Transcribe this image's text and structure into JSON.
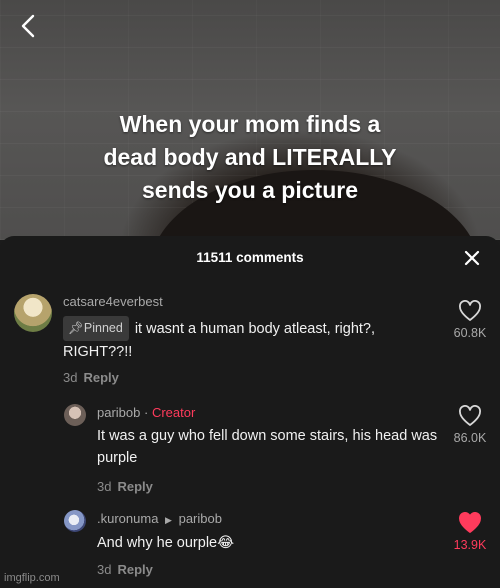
{
  "video": {
    "caption": "When your mom finds a\ndead body and LITERALLY\nsends you a picture"
  },
  "comments_sheet": {
    "count_label": "11511 comments",
    "comments": [
      {
        "username": "catsare4everbest",
        "pinned_label": "Pinned",
        "text": "it wasnt a human body atleast, right?,",
        "text_cont": "RIGHT??!!",
        "age": "3d",
        "reply_label": "Reply",
        "likes": "60.8K"
      },
      {
        "username": "paribob",
        "separator": " · ",
        "creator_label": "Creator",
        "text": "It was a guy who fell down some stairs, his head was purple",
        "age": "3d",
        "reply_label": "Reply",
        "likes": "86.0K"
      },
      {
        "username": ".kuronuma",
        "reply_to": "paribob",
        "text": "And why he ourple",
        "emoji": "😂",
        "age": "3d",
        "reply_label": "Reply",
        "likes": "13.9K",
        "liked": true
      }
    ]
  },
  "watermark": "imgflip.com",
  "colors": {
    "accent_red": "#ff3b5c",
    "sheet_bg": "#1a1a1a",
    "muted_text": "#8b8b8b"
  }
}
